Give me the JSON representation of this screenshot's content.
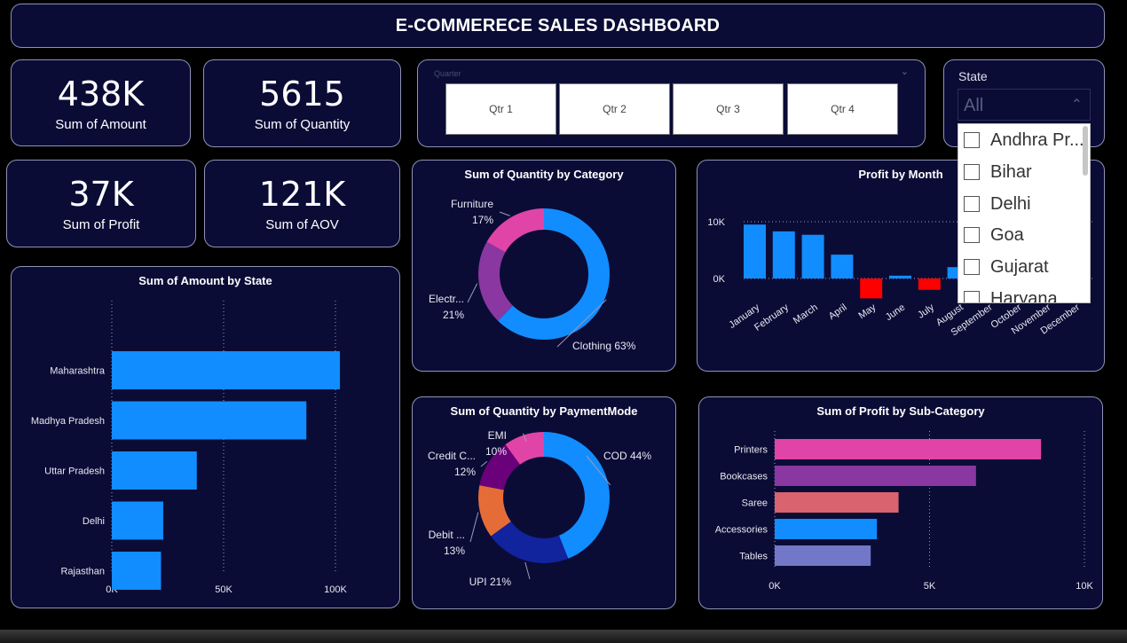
{
  "title": "E-COMMERECE SALES DASHBOARD",
  "kpis": [
    {
      "value": "438K",
      "label": "Sum of Amount"
    },
    {
      "value": "5615",
      "label": "Sum of Quantity"
    },
    {
      "value": "37K",
      "label": "Sum of Profit"
    },
    {
      "value": "121K",
      "label": "Sum of AOV"
    }
  ],
  "quarter_slicer": {
    "label": "Quarter",
    "options": [
      "Qtr 1",
      "Qtr 2",
      "Qtr 3",
      "Qtr 4"
    ]
  },
  "state_slicer": {
    "title": "State",
    "selected": "All",
    "items": [
      "Andhra Pr...",
      "Bihar",
      "Delhi",
      "Goa",
      "Gujarat",
      "Haryana"
    ]
  },
  "colors": {
    "blue": "#118dff",
    "pink": "#e044a7",
    "purple": "#8a37a1",
    "navy": "#12239e",
    "orange": "#e66c37",
    "dark_purple": "#6b007b",
    "salmon": "#d9636e",
    "lavender": "#7278c7",
    "red": "#ff0000",
    "card_bg": "#0a0c36"
  },
  "chart_data": [
    {
      "id": "amount_by_state",
      "type": "bar",
      "orientation": "horizontal",
      "title": "Sum of Amount by State",
      "categories": [
        "Maharashtra",
        "Madhya Pradesh",
        "Uttar Pradesh",
        "Delhi",
        "Rajasthan"
      ],
      "values": [
        102000,
        87000,
        38000,
        23000,
        22000
      ],
      "xlim": [
        0,
        100000
      ],
      "xticks": [
        "0K",
        "50K",
        "100K"
      ],
      "tick_values": [
        0,
        50000,
        100000
      ],
      "color": "#118dff",
      "grid": true
    },
    {
      "id": "quantity_by_category",
      "type": "pie",
      "donut": true,
      "title": "Sum of Quantity by Category",
      "slices": [
        {
          "name": "Clothing",
          "value": 63,
          "label": "Clothing 63%",
          "color": "#118dff"
        },
        {
          "name": "Electr...",
          "value": 21,
          "label": "21%",
          "color": "#8a37a1"
        },
        {
          "name": "Furniture",
          "value": 17,
          "label": "17%",
          "color": "#e044a7"
        }
      ]
    },
    {
      "id": "profit_by_month",
      "type": "bar",
      "title": "Profit by Month",
      "categories": [
        "January",
        "February",
        "March",
        "April",
        "May",
        "June",
        "July",
        "August",
        "September",
        "October",
        "November",
        "December"
      ],
      "values": [
        9500,
        8300,
        7700,
        4200,
        -3500,
        500,
        -2000,
        2000,
        0,
        0,
        0,
        0
      ],
      "yticks": [
        "0K",
        "10K"
      ],
      "tick_values": [
        0,
        10000
      ],
      "positive_color": "#118dff",
      "negative_color": "#ff0000",
      "grid": true
    },
    {
      "id": "quantity_by_paymentmode",
      "type": "pie",
      "donut": true,
      "title": "Sum of Quantity by PaymentMode",
      "slices": [
        {
          "name": "COD",
          "value": 44,
          "label": "COD 44%",
          "color": "#118dff"
        },
        {
          "name": "UPI",
          "value": 21,
          "label": "UPI 21%",
          "color": "#12239e"
        },
        {
          "name": "Debit ...",
          "value": 13,
          "label": "13%",
          "color": "#e66c37"
        },
        {
          "name": "Credit C...",
          "value": 12,
          "label": "12%",
          "color": "#6b007b"
        },
        {
          "name": "EMI",
          "value": 10,
          "label": "10%",
          "color": "#e044a7"
        }
      ]
    },
    {
      "id": "profit_by_subcategory",
      "type": "bar",
      "orientation": "horizontal",
      "title": "Sum of Profit by Sub-Category",
      "categories": [
        "Printers",
        "Bookcases",
        "Saree",
        "Accessories",
        "Tables"
      ],
      "values": [
        8600,
        6500,
        4000,
        3300,
        3100
      ],
      "colors": [
        "#e044a7",
        "#8a37a1",
        "#d9636e",
        "#118dff",
        "#7278c7"
      ],
      "xlim": [
        0,
        10000
      ],
      "xticks": [
        "0K",
        "5K",
        "10K"
      ],
      "tick_values": [
        0,
        5000,
        10000
      ],
      "grid": true
    }
  ]
}
